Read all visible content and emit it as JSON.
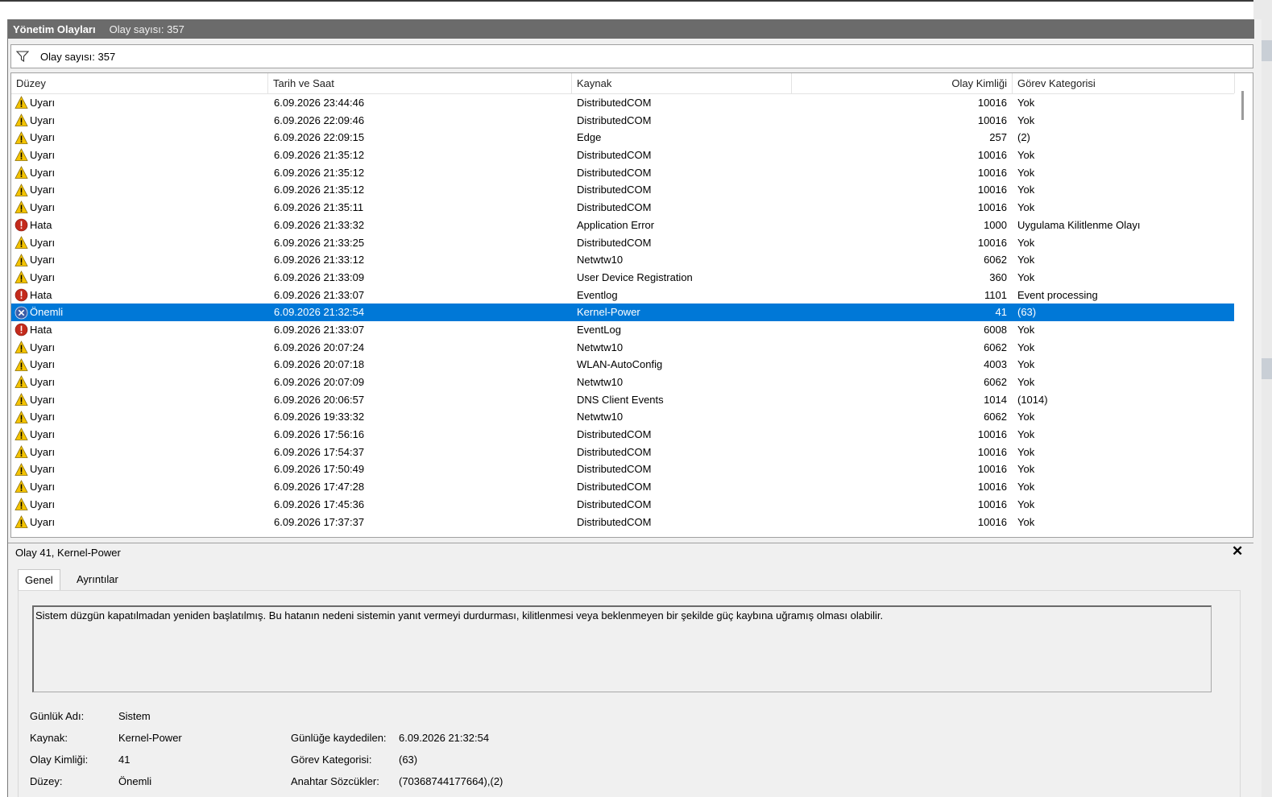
{
  "title_bar": {
    "title": "Yönetim Olayları",
    "count": "Olay sayısı: 357"
  },
  "filter_bar": {
    "text": "Olay sayısı: 357"
  },
  "columns": [
    "Düzey",
    "Tarih ve Saat",
    "Kaynak",
    "Olay Kimliği",
    "Görev Kategorisi"
  ],
  "events": [
    {
      "level": "Uyarı",
      "type": "warning",
      "date": "6.09.2026 23:44:46",
      "source": "DistributedCOM",
      "id": "10016",
      "category": "Yok"
    },
    {
      "level": "Uyarı",
      "type": "warning",
      "date": "6.09.2026 22:09:46",
      "source": "DistributedCOM",
      "id": "10016",
      "category": "Yok"
    },
    {
      "level": "Uyarı",
      "type": "warning",
      "date": "6.09.2026 22:09:15",
      "source": "Edge",
      "id": "257",
      "category": "(2)"
    },
    {
      "level": "Uyarı",
      "type": "warning",
      "date": "6.09.2026 21:35:12",
      "source": "DistributedCOM",
      "id": "10016",
      "category": "Yok"
    },
    {
      "level": "Uyarı",
      "type": "warning",
      "date": "6.09.2026 21:35:12",
      "source": "DistributedCOM",
      "id": "10016",
      "category": "Yok"
    },
    {
      "level": "Uyarı",
      "type": "warning",
      "date": "6.09.2026 21:35:12",
      "source": "DistributedCOM",
      "id": "10016",
      "category": "Yok"
    },
    {
      "level": "Uyarı",
      "type": "warning",
      "date": "6.09.2026 21:35:11",
      "source": "DistributedCOM",
      "id": "10016",
      "category": "Yok"
    },
    {
      "level": "Hata",
      "type": "error",
      "date": "6.09.2026 21:33:32",
      "source": "Application Error",
      "id": "1000",
      "category": "Uygulama Kilitlenme Olayı"
    },
    {
      "level": "Uyarı",
      "type": "warning",
      "date": "6.09.2026 21:33:25",
      "source": "DistributedCOM",
      "id": "10016",
      "category": "Yok"
    },
    {
      "level": "Uyarı",
      "type": "warning",
      "date": "6.09.2026 21:33:12",
      "source": "Netwtw10",
      "id": "6062",
      "category": "Yok"
    },
    {
      "level": "Uyarı",
      "type": "warning",
      "date": "6.09.2026 21:33:09",
      "source": "User Device Registration",
      "id": "360",
      "category": "Yok"
    },
    {
      "level": "Hata",
      "type": "error",
      "date": "6.09.2026 21:33:07",
      "source": "Eventlog",
      "id": "1101",
      "category": "Event processing"
    },
    {
      "level": "Önemli",
      "type": "critical",
      "selected": true,
      "date": "6.09.2026 21:32:54",
      "source": "Kernel-Power",
      "id": "41",
      "category": "(63)"
    },
    {
      "level": "Hata",
      "type": "error",
      "date": "6.09.2026 21:33:07",
      "source": "EventLog",
      "id": "6008",
      "category": "Yok"
    },
    {
      "level": "Uyarı",
      "type": "warning",
      "date": "6.09.2026 20:07:24",
      "source": "Netwtw10",
      "id": "6062",
      "category": "Yok"
    },
    {
      "level": "Uyarı",
      "type": "warning",
      "date": "6.09.2026 20:07:18",
      "source": "WLAN-AutoConfig",
      "id": "4003",
      "category": "Yok"
    },
    {
      "level": "Uyarı",
      "type": "warning",
      "date": "6.09.2026 20:07:09",
      "source": "Netwtw10",
      "id": "6062",
      "category": "Yok"
    },
    {
      "level": "Uyarı",
      "type": "warning",
      "date": "6.09.2026 20:06:57",
      "source": "DNS Client Events",
      "id": "1014",
      "category": "(1014)"
    },
    {
      "level": "Uyarı",
      "type": "warning",
      "date": "6.09.2026 19:33:32",
      "source": "Netwtw10",
      "id": "6062",
      "category": "Yok"
    },
    {
      "level": "Uyarı",
      "type": "warning",
      "date": "6.09.2026 17:56:16",
      "source": "DistributedCOM",
      "id": "10016",
      "category": "Yok"
    },
    {
      "level": "Uyarı",
      "type": "warning",
      "date": "6.09.2026 17:54:37",
      "source": "DistributedCOM",
      "id": "10016",
      "category": "Yok"
    },
    {
      "level": "Uyarı",
      "type": "warning",
      "date": "6.09.2026 17:50:49",
      "source": "DistributedCOM",
      "id": "10016",
      "category": "Yok"
    },
    {
      "level": "Uyarı",
      "type": "warning",
      "date": "6.09.2026 17:47:28",
      "source": "DistributedCOM",
      "id": "10016",
      "category": "Yok"
    },
    {
      "level": "Uyarı",
      "type": "warning",
      "date": "6.09.2026 17:45:36",
      "source": "DistributedCOM",
      "id": "10016",
      "category": "Yok"
    },
    {
      "level": "Uyarı",
      "type": "warning",
      "date": "6.09.2026 17:37:37",
      "source": "DistributedCOM",
      "id": "10016",
      "category": "Yok"
    }
  ],
  "detail": {
    "header": "Olay 41, Kernel-Power",
    "tabs": [
      "Genel",
      "Ayrıntılar"
    ],
    "description": "Sistem düzgün kapatılmadan yeniden başlatılmış. Bu hatanın nedeni sistemin yanıt vermeyi durdurması, kilitlenmesi veya beklenmeyen bir şekilde güç kaybına uğramış olması olabilir.",
    "fields": {
      "log_name_label": "Günlük Adı:",
      "log_name": "Sistem",
      "source_label": "Kaynak:",
      "source": "Kernel-Power",
      "logged_label": "Günlüğe kaydedilen:",
      "logged": "6.09.2026 21:32:54",
      "event_id_label": "Olay Kimliği:",
      "event_id": "41",
      "task_category_label": "Görev Kategorisi:",
      "task_category": "(63)",
      "level_label": "Düzey:",
      "level": "Önemli",
      "keywords_label": "Anahtar Sözcükler:",
      "keywords": "(70368744177664),(2)"
    }
  },
  "colors": {
    "selection": "#0078d7",
    "title_bar": "#6b6b6b",
    "warning": "#f5c400",
    "error": "#c42b1c",
    "critical": "#3b5ea8"
  }
}
